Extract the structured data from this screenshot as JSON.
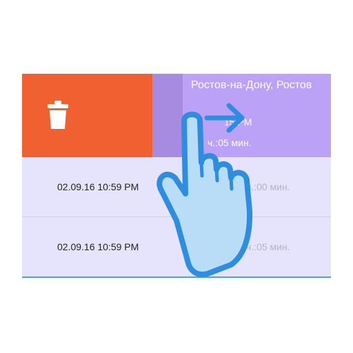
{
  "top_item": {
    "city": "Ростов-на-Дону, Ростов",
    "time": "15 PM",
    "duration": "ч.:05 мин."
  },
  "list": [
    {
      "date": "02.09.16 10:59 PM",
      "duration": "ч.:00 мин."
    },
    {
      "date": "02.09.16 10:59 PM",
      "duration": "ч.:05 мин."
    }
  ],
  "icons": {
    "delete": "trash-icon",
    "gesture": "hand-swipe-icon",
    "direction": "arrow-right-icon"
  },
  "colors": {
    "delete_bg": "#f06030",
    "card_bg": "#bca2f7",
    "list_bg": "#e6e4fc",
    "hand_fill": "#b9dcf7",
    "hand_stroke": "#2d8de0"
  }
}
